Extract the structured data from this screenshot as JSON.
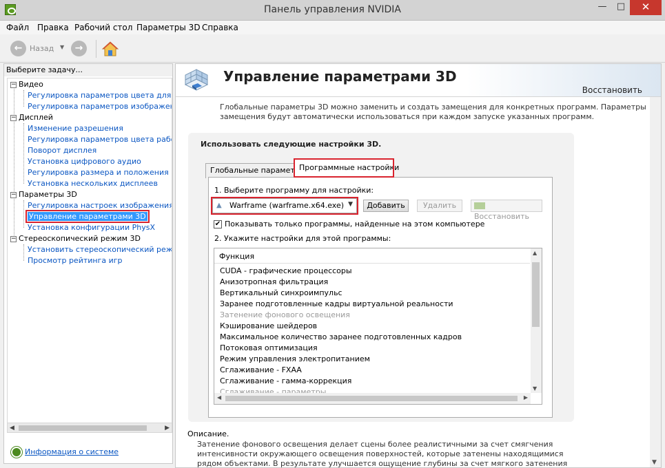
{
  "window": {
    "title": "Панель управления NVIDIA",
    "minimize": "—",
    "maximize": "□",
    "close": "✕"
  },
  "menu": [
    "Файл",
    "Правка",
    "Рабочий стол",
    "Параметры 3D",
    "Справка"
  ],
  "toolbar": {
    "back_label": "Назад",
    "icons": [
      "back-icon",
      "forward-icon",
      "home-icon"
    ]
  },
  "sidebar": {
    "header": "Выберите задачу...",
    "categories": [
      {
        "label": "Видео",
        "items": [
          "Регулировка параметров цвета для ви",
          "Регулировка параметров изображения"
        ]
      },
      {
        "label": "Дисплей",
        "items": [
          "Изменение разрешения",
          "Регулировка параметров цвета рабоче",
          "Поворот дисплея",
          "Установка цифрового аудио",
          "Регулировка размера и положения раб",
          "Установка нескольких дисплеев"
        ]
      },
      {
        "label": "Параметры 3D",
        "items": [
          "Регулировка настроек изображения с п",
          "Управление параметрами 3D",
          "Установка конфигурации PhysX"
        ]
      },
      {
        "label": "Стереоскопический режим 3D",
        "items": [
          "Установить стереоскопический режим",
          "Просмотр рейтинга игр"
        ]
      }
    ],
    "selected": "Управление параметрами 3D",
    "system_info": "Информация о системе"
  },
  "main": {
    "title": "Управление параметрами 3D",
    "restore": "Восстановить",
    "intro": "Глобальные параметры 3D можно заменить и создать замещения для конкретных программ. Параметры замещения будут автоматически использоваться при каждом запуске указанных программ.",
    "use_settings": "Использовать следующие настройки 3D.",
    "tabs": [
      {
        "label": "Глобальные параметры"
      },
      {
        "label": "Программные настройки",
        "active": true
      }
    ],
    "step1": "1. Выберите программу для настройки:",
    "program_select": "Warframe (warframe.x64.exe)",
    "buttons": {
      "add": "Добавить",
      "remove": "Удалить",
      "restore": "Восстановить"
    },
    "show_only": "Показывать только программы, найденные на этом компьютере",
    "show_only_checked": true,
    "step2": "2. Укажите настройки для этой программы:",
    "list_header": "Функция",
    "functions": [
      "CUDA - графические процессоры",
      "Анизотропная фильтрация",
      "Вертикальный синхроимпульс",
      "Заранее подготовленные кадры виртуальной реальности",
      "Затенение фонового освещения",
      "Кэширование шейдеров",
      "Максимальное количество заранее подготовленных кадров",
      "Потоковая оптимизация",
      "Режим управления электропитанием",
      "Сглаживание - FXAA",
      "Сглаживание - гамма-коррекция",
      "Сглаживание - параметры"
    ],
    "dim_function": "Затенение фонового освещения",
    "description_label": "Описание.",
    "description": "Затенение фонового освещения делает сцены более реалистичными за счет смягчения интенсивности окружающего освещения поверхностей, которые затенены находящимися рядом объектами. В результате улучшается ощущение глубины за счет мягкого затенения объектов в зависимости от их местоположения в"
  },
  "colors": {
    "accent_red": "#d9232e",
    "link": "#0a56c2",
    "selection": "#3399ff",
    "nvidia_green": "#5b9b21"
  }
}
